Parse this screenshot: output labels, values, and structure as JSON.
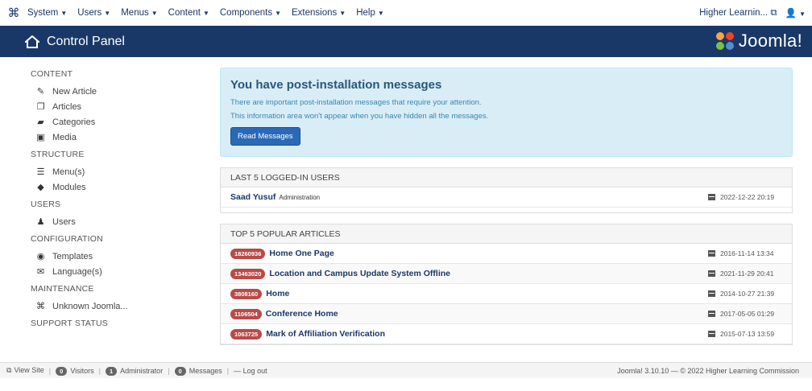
{
  "topbar": {
    "menus": [
      {
        "label": "System"
      },
      {
        "label": "Users"
      },
      {
        "label": "Menus"
      },
      {
        "label": "Content"
      },
      {
        "label": "Components"
      },
      {
        "label": "Extensions"
      },
      {
        "label": "Help"
      }
    ],
    "site_name": "Higher Learnin...",
    "user_icon": "user-icon"
  },
  "header": {
    "title": "Control Panel",
    "brand": "Joomla!"
  },
  "sidebar": {
    "groups": [
      {
        "heading": "CONTENT",
        "items": [
          {
            "label": "New Article",
            "icon": "pencil-icon"
          },
          {
            "label": "Articles",
            "icon": "copy-icon"
          },
          {
            "label": "Categories",
            "icon": "folder-icon"
          },
          {
            "label": "Media",
            "icon": "image-icon"
          }
        ]
      },
      {
        "heading": "STRUCTURE",
        "items": [
          {
            "label": "Menu(s)",
            "icon": "list-icon"
          },
          {
            "label": "Modules",
            "icon": "cube-icon"
          }
        ]
      },
      {
        "heading": "USERS",
        "items": [
          {
            "label": "Users",
            "icon": "users-icon"
          }
        ]
      },
      {
        "heading": "CONFIGURATION",
        "items": [
          {
            "label": "Templates",
            "icon": "eye-icon"
          },
          {
            "label": "Language(s)",
            "icon": "comments-icon"
          }
        ]
      },
      {
        "heading": "MAINTENANCE",
        "items": [
          {
            "label": "Unknown Joomla...",
            "icon": "joomla-icon"
          }
        ]
      },
      {
        "heading": "SUPPORT STATUS",
        "items": []
      }
    ]
  },
  "alert": {
    "title": "You have post-installation messages",
    "line1": "There are important post-installation messages that require your attention.",
    "line2": "This information area won't appear when you have hidden all the messages.",
    "button": "Read Messages"
  },
  "logged_users": {
    "heading": "LAST 5 LOGGED-IN USERS",
    "rows": [
      {
        "name": "Saad Yusuf",
        "sub": "Administration",
        "date": "2022-12-22 20:19"
      }
    ]
  },
  "popular": {
    "heading": "TOP 5 POPULAR ARTICLES",
    "rows": [
      {
        "hits": "18260936",
        "title": "Home One Page",
        "date": "2016-11-14 13:34"
      },
      {
        "hits": "13463020",
        "title": "Location and Campus Update System Offline",
        "date": "2021-11-29 20:41"
      },
      {
        "hits": "3808160",
        "title": "Home",
        "date": "2014-10-27 21:39"
      },
      {
        "hits": "1106504",
        "title": "Conference Home",
        "date": "2017-05-05 01:29"
      },
      {
        "hits": "1063725",
        "title": "Mark of Affiliation Verification",
        "date": "2015-07-13 13:59"
      }
    ]
  },
  "footer": {
    "view_site": "View Site",
    "visitors_count": "0",
    "visitors": "Visitors",
    "admin_count": "1",
    "admin": "Administrator",
    "messages_count": "0",
    "messages": "Messages",
    "logout": "Log out",
    "version": "Joomla! 3.10.10 — © 2022 Higher Learning Commission"
  }
}
